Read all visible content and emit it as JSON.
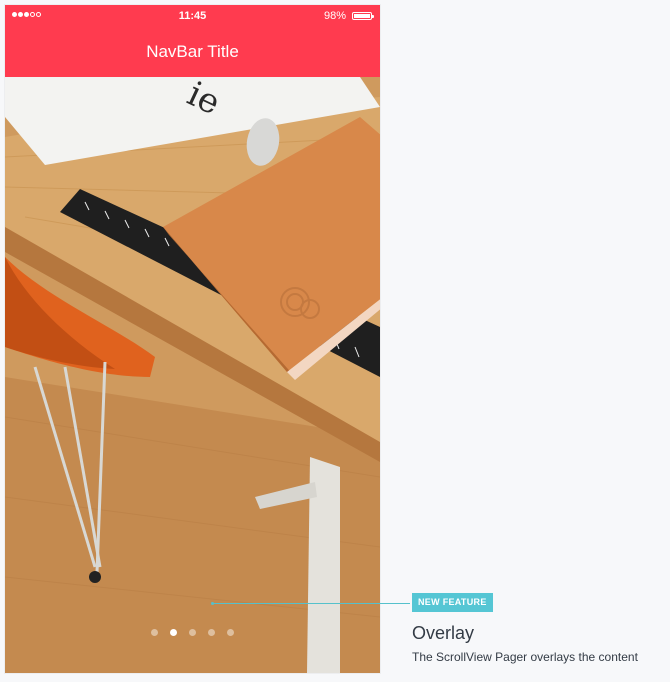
{
  "status_bar": {
    "time": "11:45",
    "battery_percent": "98%",
    "signal_dots_filled": 3,
    "signal_dots_total": 5
  },
  "navbar": {
    "title": "NavBar Title"
  },
  "pager": {
    "total_pages": 5,
    "active_index": 1
  },
  "annotation": {
    "badge": "NEW FEATURE",
    "title": "Overlay",
    "description": "The ScrollView Pager overlays the content"
  },
  "colors": {
    "accent": "#ff3b4f",
    "badge": "#55c6d4",
    "text": "#333b45",
    "background": "#f7f8fa"
  }
}
